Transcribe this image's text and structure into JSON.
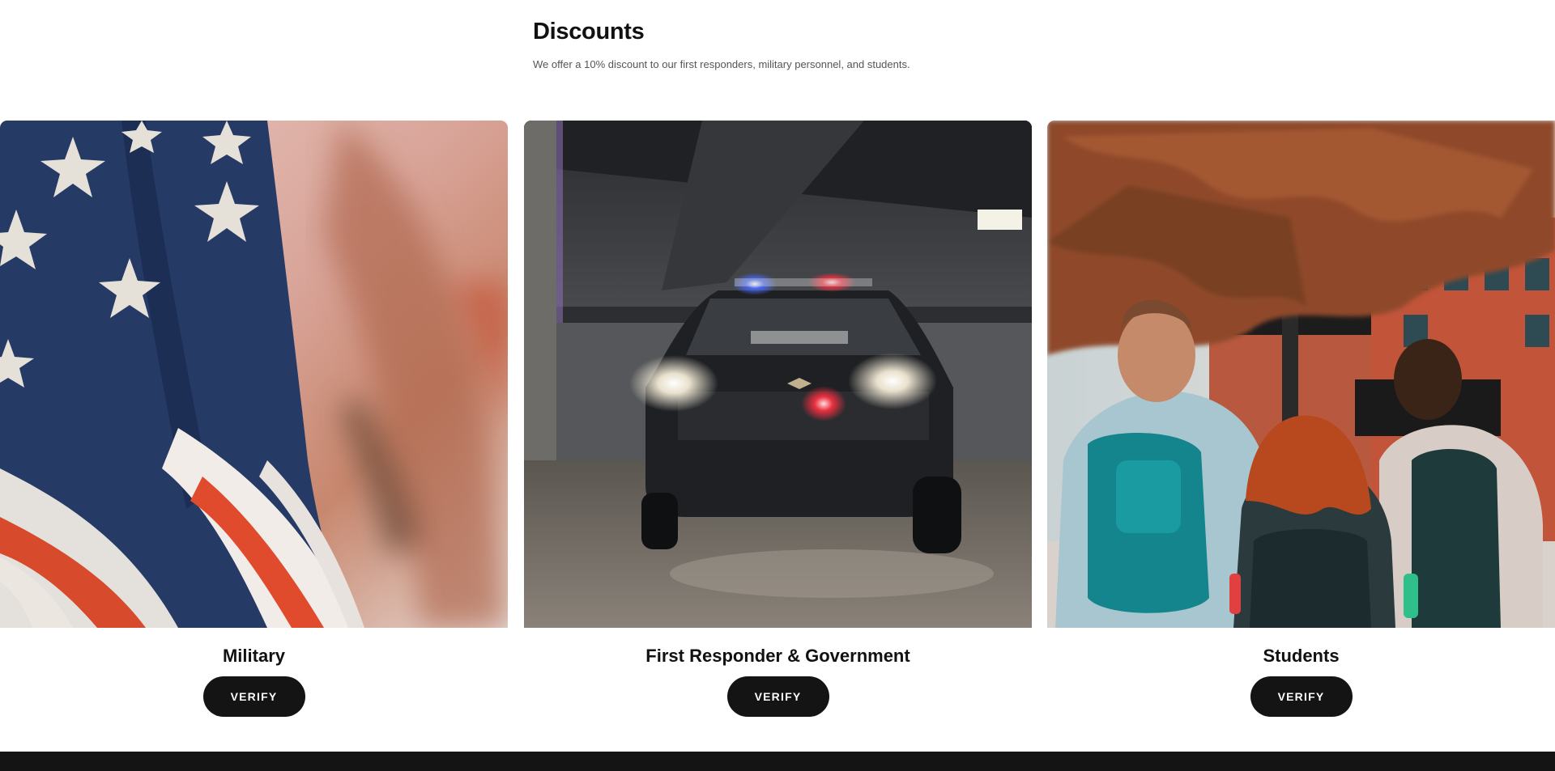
{
  "section": {
    "title": "Discounts",
    "description": "We offer a 10% discount to our first responders, military personnel, and students."
  },
  "cards": [
    {
      "title": "Military",
      "button_label": "VERIFY",
      "image": "american-flag-photo"
    },
    {
      "title": "First Responder & Government",
      "button_label": "VERIFY",
      "image": "police-car-garage-photo"
    },
    {
      "title": "Students",
      "button_label": "VERIFY",
      "image": "students-walking-photo"
    }
  ],
  "colors": {
    "button_bg": "#141414",
    "button_text": "#ffffff",
    "footer_bg": "#141414"
  }
}
